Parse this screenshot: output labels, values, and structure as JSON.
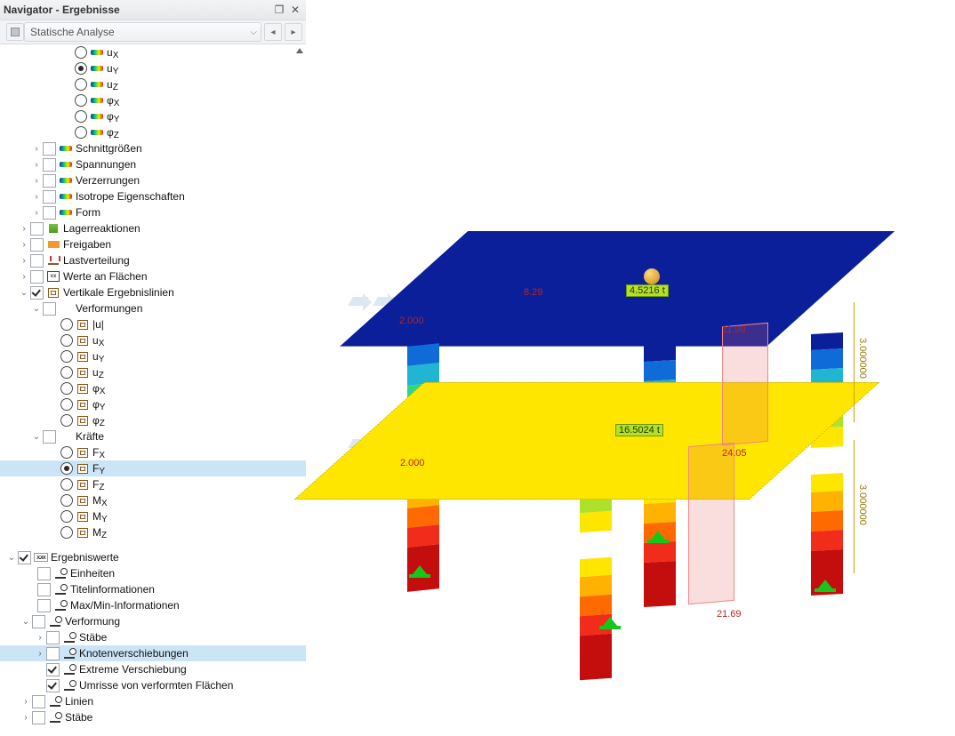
{
  "navigator": {
    "title": "Navigator - Ergebnisse",
    "dropdown": "Statische Analyse",
    "items": [
      {
        "id": "ux",
        "type": "radio",
        "sel": false,
        "label": "uX",
        "sub": "X",
        "icon": "rb",
        "indent": 84
      },
      {
        "id": "uy",
        "type": "radio",
        "sel": true,
        "label": "uY",
        "sub": "Y",
        "icon": "rb",
        "indent": 84
      },
      {
        "id": "uz",
        "type": "radio",
        "sel": false,
        "label": "uZ",
        "sub": "Z",
        "icon": "rb",
        "indent": 84
      },
      {
        "id": "phix",
        "type": "radio",
        "sel": false,
        "label": "φX",
        "sub": "X",
        "icon": "rb",
        "indent": 84
      },
      {
        "id": "phiy",
        "type": "radio",
        "sel": false,
        "label": "φY",
        "sub": "Y",
        "icon": "rb",
        "indent": 84
      },
      {
        "id": "phiz",
        "type": "radio",
        "sel": false,
        "label": "φZ",
        "sub": "Z",
        "icon": "rb",
        "indent": 84
      },
      {
        "id": "schnitt",
        "type": "cb-exp",
        "sel": false,
        "label": "Schnittgrößen",
        "icon": "rb",
        "indent": 34,
        "ex": ">"
      },
      {
        "id": "spann",
        "type": "cb-exp",
        "sel": false,
        "label": "Spannungen",
        "icon": "rb",
        "indent": 34,
        "ex": ">"
      },
      {
        "id": "verz",
        "type": "cb-exp",
        "sel": false,
        "label": "Verzerrungen",
        "icon": "rb",
        "indent": 34,
        "ex": ">"
      },
      {
        "id": "iso",
        "type": "cb-exp",
        "sel": false,
        "label": "Isotrope Eigenschaften",
        "icon": "rb",
        "indent": 34,
        "ex": ">"
      },
      {
        "id": "form",
        "type": "cb-exp",
        "sel": false,
        "label": "Form",
        "icon": "rb",
        "indent": 34,
        "ex": ">"
      },
      {
        "id": "lager",
        "type": "cb",
        "sel": false,
        "label": "Lagerreaktionen",
        "icon": "sup",
        "indent": 20,
        "ex": ">"
      },
      {
        "id": "freig",
        "type": "cb",
        "sel": false,
        "label": "Freigaben",
        "icon": "rel",
        "indent": 20,
        "ex": ">"
      },
      {
        "id": "lastv",
        "type": "cb",
        "sel": false,
        "label": "Lastverteilung",
        "icon": "ldis",
        "indent": 20,
        "ex": ">"
      },
      {
        "id": "wertefl",
        "type": "cb",
        "sel": false,
        "label": "Werte an Flächen",
        "icon": "wert",
        "indent": 20,
        "ex": ">"
      },
      {
        "id": "vertikal",
        "type": "cb",
        "sel": true,
        "label": "Vertikale Ergebnislinien",
        "icon": "aq",
        "indent": 20,
        "ex": "v"
      },
      {
        "id": "verformungen",
        "type": "cb-exp",
        "sel": false,
        "label": "Verformungen",
        "icon": "",
        "indent": 34,
        "ex": "v"
      },
      {
        "id": "u_abs",
        "type": "radio",
        "sel": false,
        "label": "|u|",
        "icon": "aq",
        "indent": 68
      },
      {
        "id": "v_ux",
        "type": "radio",
        "sel": false,
        "label": "uX",
        "sub": "X",
        "icon": "aq",
        "indent": 68
      },
      {
        "id": "v_uy",
        "type": "radio",
        "sel": false,
        "label": "uY",
        "sub": "Y",
        "icon": "aq",
        "indent": 68
      },
      {
        "id": "v_uz",
        "type": "radio",
        "sel": false,
        "label": "uZ",
        "sub": "Z",
        "icon": "aq",
        "indent": 68
      },
      {
        "id": "v_phix",
        "type": "radio",
        "sel": false,
        "label": "φX",
        "sub": "X",
        "icon": "aq",
        "indent": 68
      },
      {
        "id": "v_phiy",
        "type": "radio",
        "sel": false,
        "label": "φY",
        "sub": "Y",
        "icon": "aq",
        "indent": 68
      },
      {
        "id": "v_phiz",
        "type": "radio",
        "sel": false,
        "label": "φZ",
        "sub": "Z",
        "icon": "aq",
        "indent": 68
      },
      {
        "id": "kraefte",
        "type": "cb-exp",
        "sel": false,
        "label": "Kräfte",
        "icon": "",
        "indent": 34,
        "ex": "v"
      },
      {
        "id": "fx",
        "type": "radio",
        "sel": false,
        "label": "FX",
        "sub": "X",
        "icon": "aq",
        "indent": 68
      },
      {
        "id": "fy",
        "type": "radio",
        "sel": true,
        "label": "FY",
        "sub": "Y",
        "icon": "aq",
        "indent": 68,
        "selrow": true
      },
      {
        "id": "fz",
        "type": "radio",
        "sel": false,
        "label": "FZ",
        "sub": "Z",
        "icon": "aq",
        "indent": 68
      },
      {
        "id": "mx",
        "type": "radio",
        "sel": false,
        "label": "MX",
        "sub": "X",
        "icon": "aq",
        "indent": 68
      },
      {
        "id": "my",
        "type": "radio",
        "sel": false,
        "label": "MY",
        "sub": "Y",
        "icon": "aq",
        "indent": 68
      },
      {
        "id": "mz",
        "type": "radio",
        "sel": false,
        "label": "MZ",
        "sub": "Z",
        "icon": "aq",
        "indent": 68
      },
      {
        "id": "gap",
        "type": "gap"
      },
      {
        "id": "ergwerte",
        "type": "cb",
        "sel": true,
        "label": "Ergebniswerte",
        "icon": "xxx",
        "indent": 6,
        "ex": "v"
      },
      {
        "id": "einheiten",
        "type": "cb",
        "sel": false,
        "label": "Einheiten",
        "icon": "und",
        "indent": 42
      },
      {
        "id": "titel",
        "type": "cb",
        "sel": false,
        "label": "Titelinformationen",
        "icon": "und",
        "indent": 42
      },
      {
        "id": "maxmin",
        "type": "cb",
        "sel": false,
        "label": "Max/Min-Informationen",
        "icon": "und",
        "indent": 42
      },
      {
        "id": "verformung",
        "type": "cb-exp",
        "sel": false,
        "label": "Verformung",
        "icon": "und",
        "indent": 22,
        "ex": "v"
      },
      {
        "id": "staebe1",
        "type": "cb-exp",
        "sel": false,
        "label": "Stäbe",
        "icon": "und",
        "indent": 38,
        "ex": ">"
      },
      {
        "id": "knot",
        "type": "cb-exp",
        "sel": false,
        "label": "Knotenverschiebungen",
        "icon": "und",
        "indent": 38,
        "ex": ">",
        "selrow": true
      },
      {
        "id": "extrem",
        "type": "cb",
        "sel": true,
        "label": "Extreme Verschiebung",
        "icon": "und",
        "indent": 52
      },
      {
        "id": "umrisse",
        "type": "cb",
        "sel": true,
        "label": "Umrisse von verformten Flächen",
        "icon": "und",
        "indent": 52
      },
      {
        "id": "linien",
        "type": "cb-exp",
        "sel": false,
        "label": "Linien",
        "icon": "und",
        "indent": 22,
        "ex": ">"
      },
      {
        "id": "staebe2",
        "type": "cb-exp",
        "sel": false,
        "label": "Stäbe",
        "icon": "und",
        "indent": 22,
        "ex": ">"
      }
    ]
  },
  "viewport": {
    "annotations": {
      "v1": "8.29",
      "v2": "2.000",
      "v3": "2.000",
      "v4": "11.99",
      "v5": "24.05",
      "v6": "21.69",
      "tag1": "4.5216 t",
      "tag2": "16.5024 t",
      "dim1": "3.000000",
      "dim2": "3.000000"
    }
  }
}
